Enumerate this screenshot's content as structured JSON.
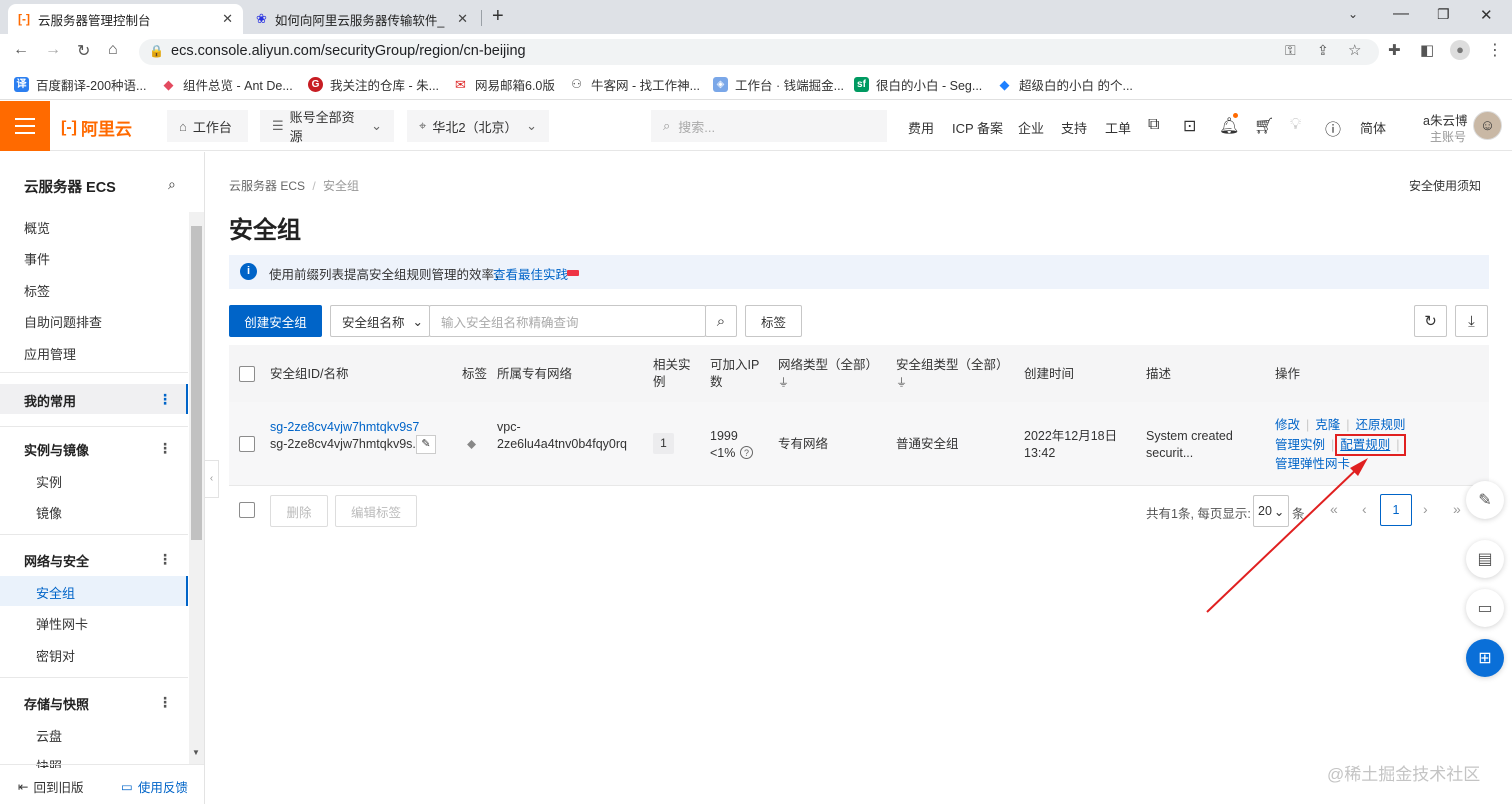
{
  "browser": {
    "tabs": [
      {
        "title": "云服务器管理控制台",
        "active": true
      },
      {
        "title": "如何向阿里云服务器传输软件_百",
        "active": false
      }
    ],
    "new_tab": "+",
    "url": "ecs.console.aliyun.com/securityGroup/region/cn-beijing",
    "bookmarks": [
      "百度翻译-200种语...",
      "组件总览 - Ant De...",
      "我关注的仓库 - 朱...",
      "网易邮箱6.0版",
      "牛客网 - 找工作神...",
      "工作台 · 钱端掘金...",
      "很白的小白 - Seg...",
      "超级白的小白 的个..."
    ]
  },
  "topbar": {
    "logo": "阿里云",
    "workbench": "工作台",
    "account_resources": "账号全部资源",
    "region": "华北2（北京）",
    "search_placeholder": "搜索...",
    "links": [
      "费用",
      "ICP 备案",
      "企业",
      "支持",
      "工单"
    ],
    "lang": "简体",
    "user_name": "a朱云博",
    "user_role": "主账号"
  },
  "sidebar": {
    "title": "云服务器 ECS",
    "top_items": [
      "概览",
      "事件",
      "标签",
      "自助问题排查",
      "应用管理"
    ],
    "favorites": "我的常用",
    "groups": [
      {
        "label": "实例与镜像",
        "items": [
          "实例",
          "镜像"
        ]
      },
      {
        "label": "网络与安全",
        "items": [
          "安全组",
          "弹性网卡",
          "密钥对"
        ]
      },
      {
        "label": "存储与快照",
        "items": [
          "云盘",
          "快照"
        ]
      }
    ],
    "footer_old": "回到旧版",
    "footer_feedback": "使用反馈"
  },
  "content": {
    "breadcrumb": [
      "云服务器 ECS",
      "安全组"
    ],
    "security_notice": "安全使用须知",
    "page_title": "安全组",
    "info_text": "使用前缀列表提高安全组规则管理的效率，",
    "info_link": "查看最佳实践",
    "create_button": "创建安全组",
    "search_select": "安全组名称",
    "search_placeholder": "输入安全组名称精确查询",
    "tag_button": "标签",
    "columns": [
      "安全组ID/名称",
      "标签",
      "所属专有网络",
      "相关实例",
      "可加入IP数",
      "网络类型（全部）",
      "安全组类型（全部）",
      "创建时间",
      "描述",
      "操作"
    ],
    "row": {
      "id": "sg-2ze8cv4vjw7hmtqkv9s7",
      "name": "sg-2ze8cv4vjw7hmtqkv9s...",
      "vpc_line1": "vpc-",
      "vpc_line2": "2ze6lu4a4tnv0b4fqy0rq",
      "instances": "1",
      "ip_count": "1999",
      "ip_pct": "<1%",
      "network_type": "专有网络",
      "sg_type": "普通安全组",
      "created_line1": "2022年12月18日",
      "created_line2": "13:42",
      "desc_line1": "System created",
      "desc_line2": "securit...",
      "actions": [
        "修改",
        "克隆",
        "还原规则",
        "管理实例",
        "配置规则",
        "管理弹性网卡"
      ]
    },
    "delete_button": "删除",
    "edit_tags_button": "编辑标签",
    "pagination_text": "共有1条, 每页显示:",
    "page_size": "20",
    "page_unit": "条",
    "current_page": "1"
  },
  "watermark": "@稀土掘金技术社区",
  "colors": {
    "brand": "#ff6a00",
    "primary": "#0064c8",
    "highlight": "#e02020"
  }
}
